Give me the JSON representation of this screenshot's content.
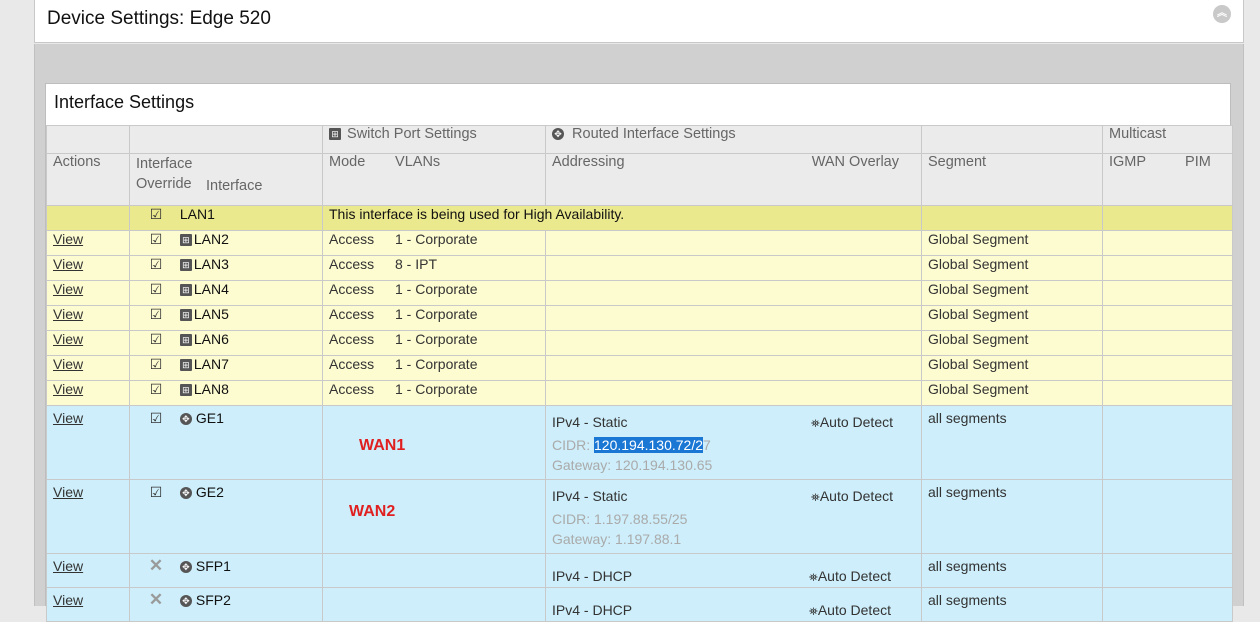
{
  "page": {
    "title": "Device Settings: Edge 520",
    "collapse_icon": "double-chevron-up-icon"
  },
  "panel": {
    "title": "Interface Settings"
  },
  "headers": {
    "switch_port_settings": "Switch Port Settings",
    "routed_interface_settings": "Routed Interface Settings",
    "multicast": "Multicast",
    "actions": "Actions",
    "interface_override_line1": "Interface",
    "interface_override_line2": "Override",
    "interface": "Interface",
    "mode": "Mode",
    "vlans": "VLANs",
    "addressing": "Addressing",
    "wan_overlay": "WAN Overlay",
    "segment": "Segment",
    "igmp": "IGMP",
    "pim": "PIM"
  },
  "ha_row": {
    "interface": "LAN1",
    "message": "This interface is being used for High Availability."
  },
  "lan_rows": [
    {
      "action": "View",
      "interface": "LAN2",
      "mode": "Access",
      "vlan": "1 - Corporate",
      "segment": "Global Segment"
    },
    {
      "action": "View",
      "interface": "LAN3",
      "mode": "Access",
      "vlan": "8 - IPT",
      "segment": "Global Segment"
    },
    {
      "action": "View",
      "interface": "LAN4",
      "mode": "Access",
      "vlan": "1 - Corporate",
      "segment": "Global Segment"
    },
    {
      "action": "View",
      "interface": "LAN5",
      "mode": "Access",
      "vlan": "1 - Corporate",
      "segment": "Global Segment"
    },
    {
      "action": "View",
      "interface": "LAN6",
      "mode": "Access",
      "vlan": "1 - Corporate",
      "segment": "Global Segment"
    },
    {
      "action": "View",
      "interface": "LAN7",
      "mode": "Access",
      "vlan": "1 - Corporate",
      "segment": "Global Segment"
    },
    {
      "action": "View",
      "interface": "LAN8",
      "mode": "Access",
      "vlan": "1 - Corporate",
      "segment": "Global Segment"
    }
  ],
  "wan_rows": [
    {
      "action": "View",
      "interface": "GE1",
      "annotation": "WAN1",
      "addressing": "IPv4 - Static",
      "cidr_label": "CIDR: ",
      "cidr_highlight": "120.194.130.72/2",
      "cidr_rest": "7",
      "gateway": "Gateway: 120.194.130.65",
      "wan_overlay": "Auto Detect",
      "segment": "all segments"
    },
    {
      "action": "View",
      "interface": "GE2",
      "annotation": "WAN2",
      "addressing": "IPv4 - Static",
      "cidr": "CIDR: 1.197.88.55/25",
      "gateway": "Gateway: 1.197.88.1",
      "wan_overlay": "Auto Detect",
      "segment": "all segments"
    },
    {
      "action": "View",
      "interface": "SFP1",
      "addressing": "IPv4 - DHCP",
      "wan_overlay": "Auto Detect",
      "segment": "all segments"
    },
    {
      "action": "View",
      "interface": "SFP2",
      "addressing": "IPv4 - DHCP",
      "wan_overlay": "Auto Detect",
      "segment": "all segments"
    }
  ],
  "colors": {
    "ha_row": "#ebe98e",
    "lan_row": "#fdfbd0",
    "wan_row": "#cdeefa",
    "highlight": "#1a77d4",
    "annotation": "#e02020"
  }
}
